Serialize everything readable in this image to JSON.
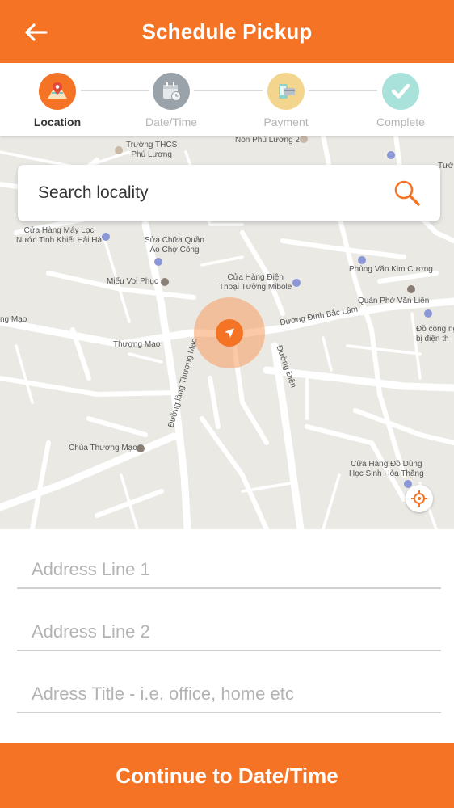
{
  "header": {
    "title": "Schedule Pickup",
    "back_icon": "arrow-left-icon"
  },
  "stepper": {
    "steps": [
      {
        "label": "Location",
        "icon": "map-location-icon",
        "color": "#F47324",
        "active": true
      },
      {
        "label": "Date/Time",
        "icon": "calendar-icon",
        "color": "#9AA3AA",
        "active": false
      },
      {
        "label": "Payment",
        "icon": "payment-card-icon",
        "color": "#F3D58E",
        "active": false
      },
      {
        "label": "Complete",
        "icon": "checkmark-icon",
        "color": "#A9E2DA",
        "active": false
      }
    ]
  },
  "search": {
    "placeholder": "Search locality"
  },
  "map": {
    "pois": [
      {
        "name": "Trường THCS\nPhú Lương"
      },
      {
        "name": "Non Phú Lương 2"
      },
      {
        "name": "Tướ"
      },
      {
        "name": "Cửa Hàng Máy Lọc\nNước Tinh Khiết Hải Hà"
      },
      {
        "name": "Sửa Chữa Quần\nÁo Chợ Cống"
      },
      {
        "name": "Phùng Văn Kim Cương"
      },
      {
        "name": "Miếu Voi Phục"
      },
      {
        "name": "Cửa Hàng Điện\nThoại Tường Mibole"
      },
      {
        "name": "Quán Phở Văn Liên"
      },
      {
        "name": "ng Mạo"
      },
      {
        "name": "Đường Đình Bắc Lâm"
      },
      {
        "name": "Đồ công ng\nbị điện th"
      },
      {
        "name": "Thượng Mạo"
      },
      {
        "name": "Đường Điện"
      },
      {
        "name": "Đường làng Thượng Mạo"
      },
      {
        "name": "Chùa Thượng Mạo"
      },
      {
        "name": "Cửa Hàng Đồ Dùng\nHọc Sinh Hòa Thắng"
      }
    ]
  },
  "form": {
    "address_line_1_placeholder": "Address Line 1",
    "address_line_2_placeholder": "Address Line 2",
    "address_title_placeholder": "Adress Title - i.e. office, home etc"
  },
  "cta": {
    "label": "Continue to Date/Time"
  },
  "colors": {
    "accent": "#F47324",
    "halo": "#F79D60"
  }
}
